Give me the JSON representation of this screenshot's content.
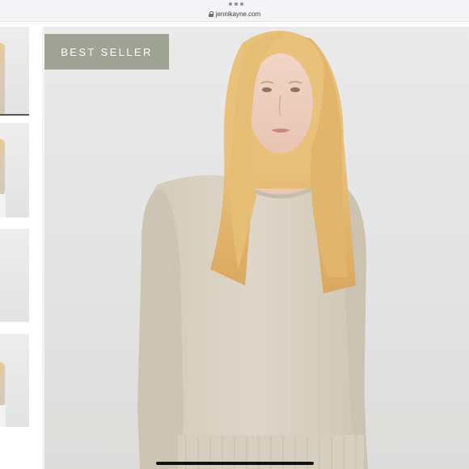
{
  "browser": {
    "url": "jennikayne.com",
    "menu_icon": "more-dots-icon",
    "lock_icon": "lock-icon"
  },
  "product": {
    "badge": "BEST SELLER",
    "image_alt": "Model wearing a beige crew-neck cashmere sweater"
  },
  "gallery": {
    "thumbnail_count": 4,
    "selected_index": 0
  },
  "colors": {
    "badge_bg": "#9ea393",
    "sweater": "#d9d1c3",
    "backdrop": "#e4e5e4"
  }
}
